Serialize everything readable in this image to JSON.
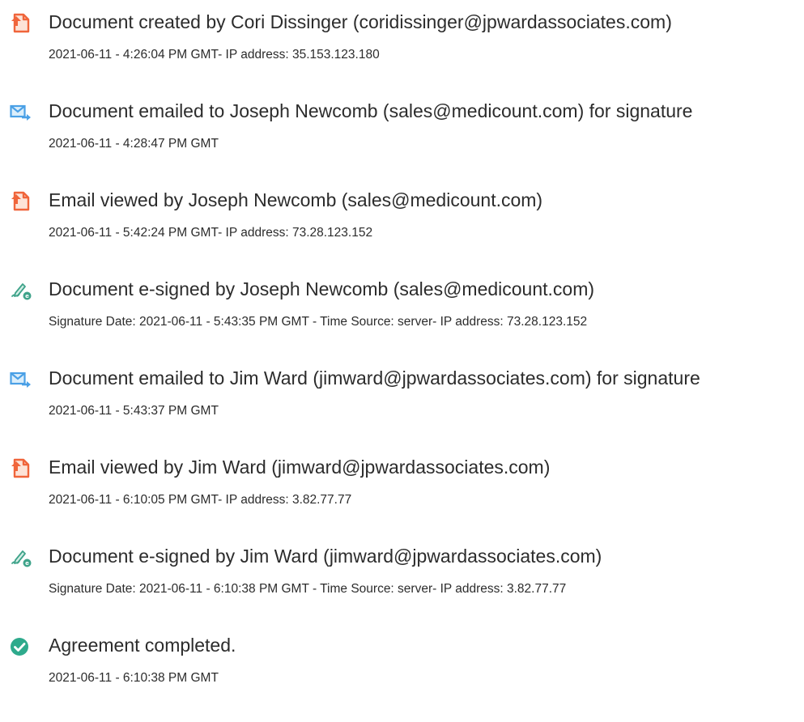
{
  "events": [
    {
      "icon": "document-created-icon",
      "title": "Document created by Cori Dissinger (coridissinger@jpwardassociates.com)",
      "detail": "2021-06-11 - 4:26:04 PM GMT- IP address: 35.153.123.180"
    },
    {
      "icon": "document-emailed-icon",
      "title": "Document emailed to Joseph Newcomb (sales@medicount.com) for signature",
      "detail": "2021-06-11 - 4:28:47 PM GMT"
    },
    {
      "icon": "email-viewed-icon",
      "title": "Email viewed by Joseph Newcomb (sales@medicount.com)",
      "detail": "2021-06-11 - 5:42:24 PM GMT- IP address: 73.28.123.152"
    },
    {
      "icon": "e-signed-icon",
      "title": "Document e-signed by Joseph Newcomb (sales@medicount.com)",
      "detail": "Signature Date: 2021-06-11 - 5:43:35 PM GMT - Time Source: server- IP address: 73.28.123.152"
    },
    {
      "icon": "document-emailed-icon",
      "title": "Document emailed to Jim Ward (jimward@jpwardassociates.com) for signature",
      "detail": "2021-06-11 - 5:43:37 PM GMT"
    },
    {
      "icon": "email-viewed-icon",
      "title": "Email viewed by Jim Ward (jimward@jpwardassociates.com)",
      "detail": "2021-06-11 - 6:10:05 PM GMT- IP address: 3.82.77.77"
    },
    {
      "icon": "e-signed-icon",
      "title": "Document e-signed by Jim Ward (jimward@jpwardassociates.com)",
      "detail": "Signature Date: 2021-06-11 - 6:10:38 PM GMT - Time Source: server- IP address: 3.82.77.77"
    },
    {
      "icon": "agreement-completed-icon",
      "title": "Agreement completed.",
      "detail": "2021-06-11 - 6:10:38 PM GMT"
    }
  ],
  "colors": {
    "doc_orange": "#f0653b",
    "email_blue": "#4aa0e6",
    "sign_green": "#3fa38a",
    "complete_teal": "#2eaa8c",
    "text": "#2c2c2c"
  }
}
